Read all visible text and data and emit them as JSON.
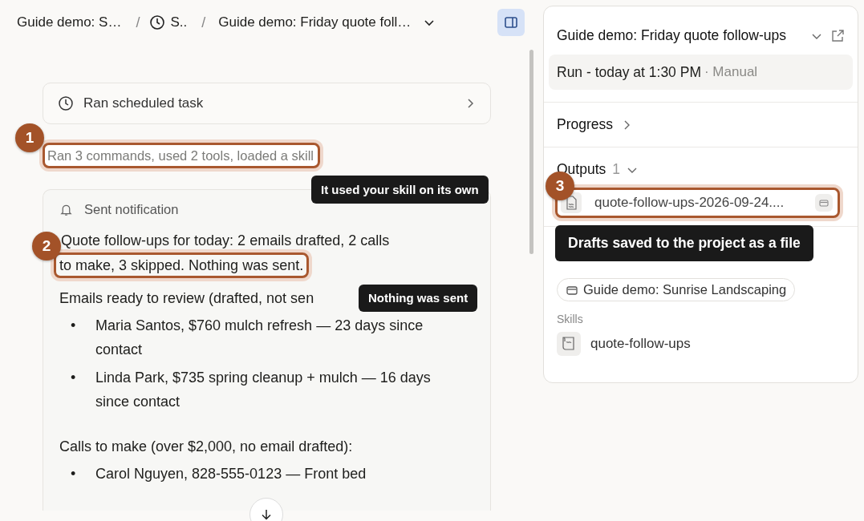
{
  "breadcrumb": [
    {
      "kind": "project",
      "label": "Guide demo: S…"
    },
    {
      "kind": "schedule",
      "separator": "/",
      "label": "S.."
    },
    {
      "kind": "task",
      "separator": "/",
      "label": "Guide demo: Friday quote foll…"
    }
  ],
  "thread": {
    "task_card": "Ran scheduled task",
    "activity_summary": "Ran 3 commands, used 2 tools, loaded a skill",
    "notification": {
      "label": "Sent notification",
      "summary_lead": "Quote follow-ups for today: 2 emails drafted, 2 calls",
      "summary_tail": "to make, 3 skipped. Nothing was sent.",
      "sections": [
        {
          "heading": "Emails ready to review (drafted, not sen",
          "items": [
            {
              "marker": "•",
              "text": "Maria Santos, $760 mulch refresh — 23 days since contact"
            },
            {
              "marker": "•",
              "text": "Linda Park, $735 spring cleanup + mulch — 16 days since contact"
            }
          ]
        },
        {
          "heading": "Calls to make (over $2,000, no email drafted):",
          "items": [
            {
              "marker": "•",
              "text": "Carol Nguyen, 828-555-0123 — Front bed"
            }
          ]
        }
      ]
    }
  },
  "panel": {
    "title": "Guide demo: Friday quote follow-ups",
    "run": "Run - today at 1:30 PM",
    "trigger": "· Manual",
    "progress": "Progress",
    "outputs_label": "Outputs",
    "outputs_count": "1",
    "output_file": "quote-follow-ups-2026-09-24....",
    "project": "Guide demo: Sunrise Landscaping",
    "skills_label": "Skills",
    "skill": "quote-follow-ups"
  },
  "annotations": [
    {
      "number": "1",
      "tooltip": "It used your skill on its own"
    },
    {
      "number": "2",
      "tooltip": "Nothing was sent"
    },
    {
      "number": "3",
      "tooltip": "Drafts saved to the project as a file"
    }
  ]
}
